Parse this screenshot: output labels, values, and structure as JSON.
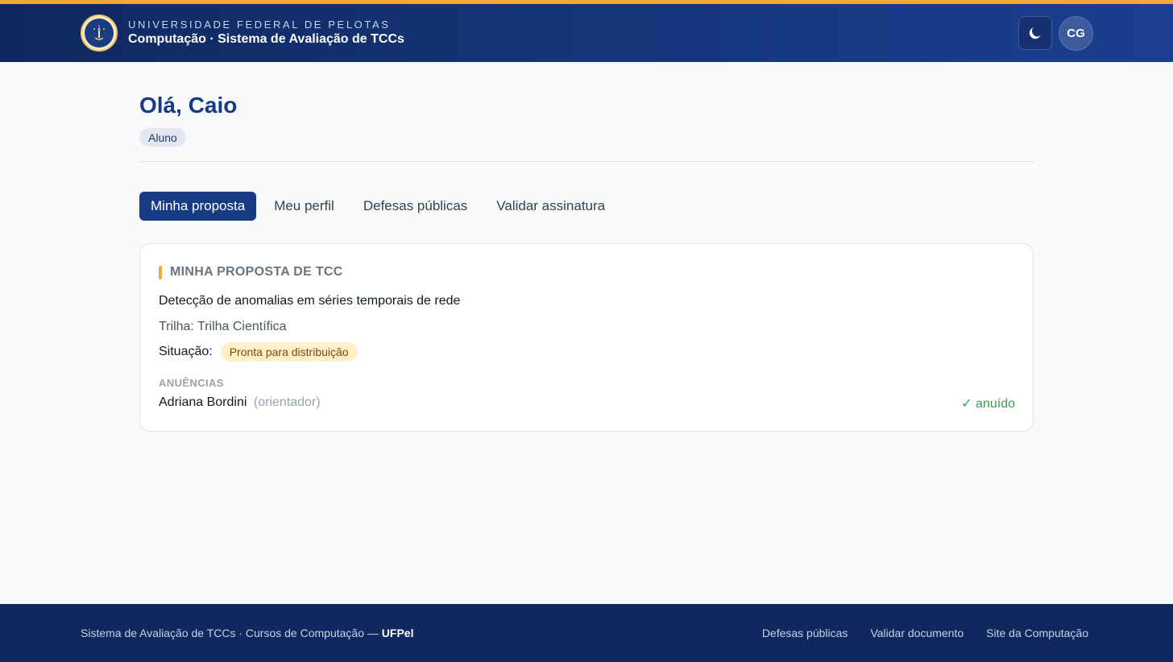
{
  "header": {
    "university": "UNIVERSIDADE FEDERAL DE PELOTAS",
    "system": "Computação · Sistema de Avaliação de TCCs",
    "avatar_initials": "CG",
    "accent_color": "#f0a93b",
    "brand_color": "#163a84",
    "theme_icon": "moon-icon"
  },
  "main": {
    "greeting": "Olá, Caio",
    "role": "Aluno",
    "tabs": [
      {
        "label": "Minha proposta",
        "active": true
      },
      {
        "label": "Meu perfil",
        "active": false
      },
      {
        "label": "Defesas públicas",
        "active": false
      },
      {
        "label": "Validar assinatura",
        "active": false
      }
    ]
  },
  "proposal": {
    "section_title": "MINHA PROPOSTA DE TCC",
    "title": "Detecção de anomalias em séries temporais de rede",
    "track": "Trilha: Trilha Científica",
    "status_label": "Situação:",
    "status_value": "Pronta para distribuição",
    "consents_label": "ANUÊNCIAS",
    "consents": [
      {
        "name": "Adriana Bordini",
        "role": "(orientador)",
        "status": "✓ anuído"
      }
    ]
  },
  "footer": {
    "text": "Sistema de Avaliação de TCCs · Cursos de Computação — ",
    "institution": "UFPel",
    "links": [
      "Defesas públicas",
      "Validar documento",
      "Site da Computação"
    ]
  }
}
